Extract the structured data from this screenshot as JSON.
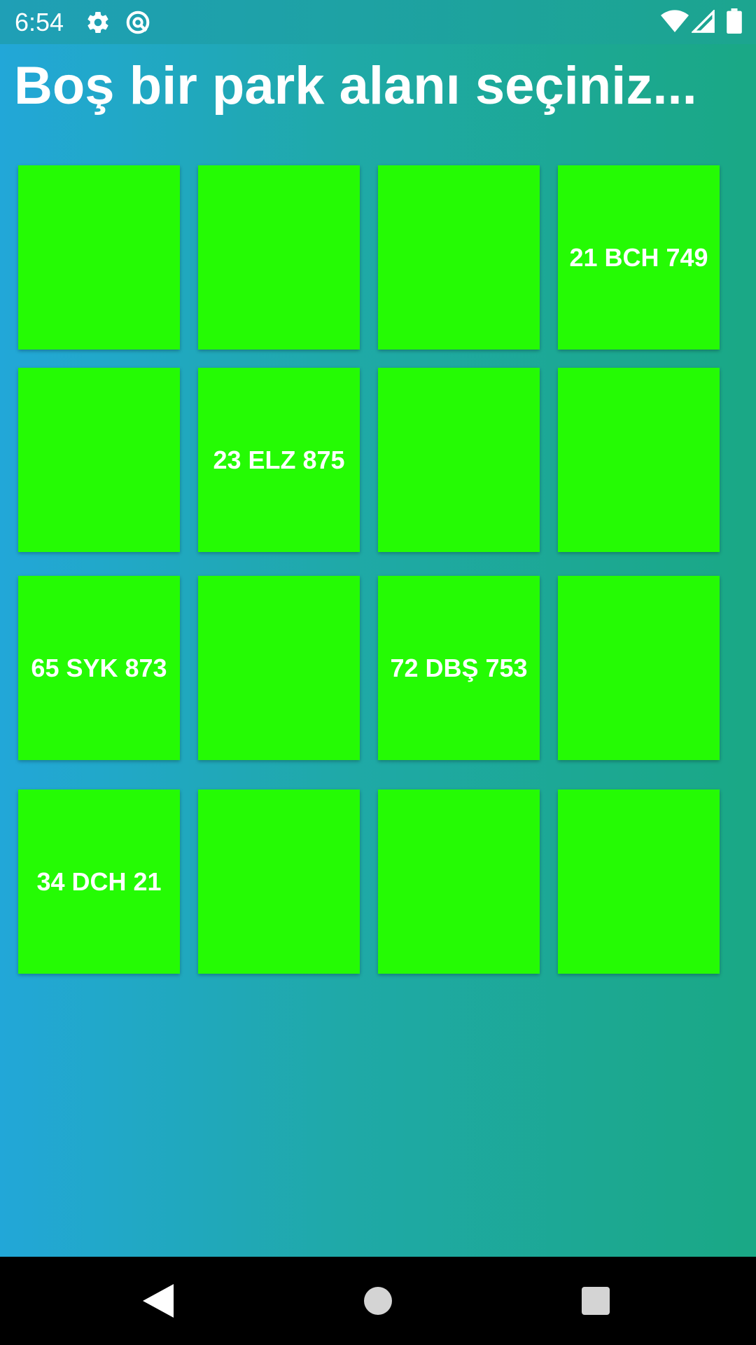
{
  "status_bar": {
    "time": "6:54",
    "icons": [
      "gear-icon",
      "sync-icon",
      "wifi-icon",
      "signal-icon",
      "battery-icon"
    ]
  },
  "header": {
    "title": "Boş bir park alanı seçiniz..."
  },
  "parking": {
    "slot_color": "#25fb04",
    "rows": [
      [
        {
          "plate": ""
        },
        {
          "plate": ""
        },
        {
          "plate": ""
        },
        {
          "plate": "21 BCH 749"
        }
      ],
      [
        {
          "plate": ""
        },
        {
          "plate": "23 ELZ 875"
        },
        {
          "plate": ""
        },
        {
          "plate": ""
        }
      ],
      [
        {
          "plate": "65 SYK 873"
        },
        {
          "plate": ""
        },
        {
          "plate": "72 DBŞ 753"
        },
        {
          "plate": ""
        }
      ],
      [
        {
          "plate": "34 DCH 21"
        },
        {
          "plate": ""
        },
        {
          "plate": ""
        },
        {
          "plate": ""
        }
      ]
    ]
  },
  "nav_bar": {
    "buttons": [
      "back-icon",
      "home-icon",
      "recents-icon"
    ]
  }
}
